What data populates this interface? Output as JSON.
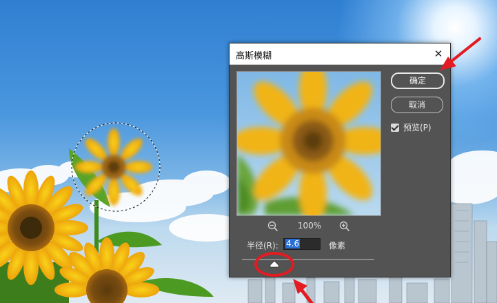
{
  "dialog": {
    "title": "高斯模糊",
    "close_icon": "close-icon",
    "ok_label": "确定",
    "cancel_label": "取消",
    "preview_label": "预览(P)",
    "preview_checked": true,
    "zoom_percent": "100%",
    "zoom_out_icon": "zoom-out-icon",
    "zoom_in_icon": "zoom-in-icon",
    "radius_label": "半径(R):",
    "radius_value": "4.6",
    "radius_unit": "像素"
  },
  "colors": {
    "dialog_bg": "#535353",
    "annotation_red": "#e31b23",
    "input_selection": "#2a6fd6"
  }
}
